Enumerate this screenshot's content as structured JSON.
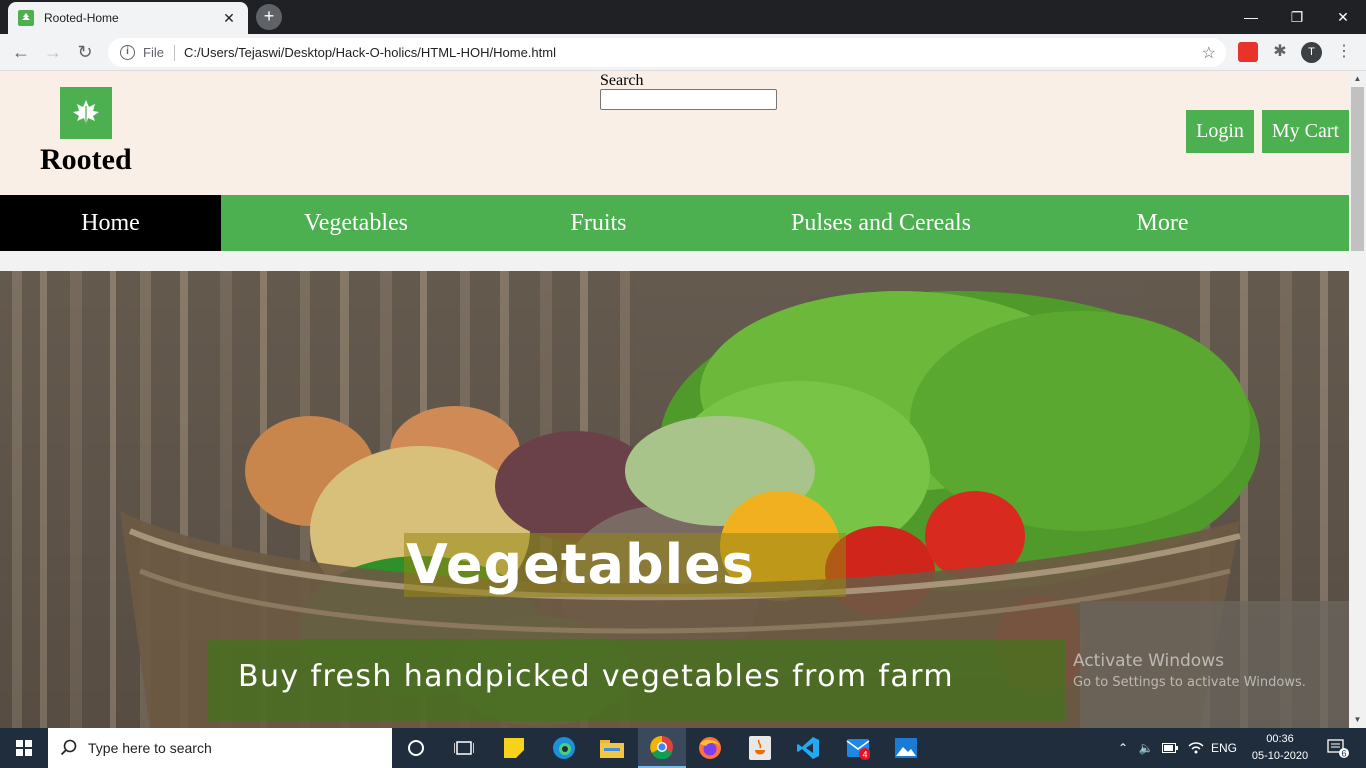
{
  "browser": {
    "tab_title": "Rooted-Home",
    "tab_close": "✕",
    "new_tab": "+",
    "url_scheme": "File",
    "url": "C:/Users/Tejaswi/Desktop/Hack-O-holics/HTML-HOH/Home.html",
    "profile_initial": "T",
    "window_controls": {
      "minimize": "—",
      "restore": "❐",
      "close": "✕"
    }
  },
  "site": {
    "brand": "Rooted",
    "search_label": "Search",
    "search_value": "",
    "login_label": "Login",
    "cart_label": "My Cart",
    "nav": [
      {
        "label": "Home",
        "active": true
      },
      {
        "label": "Vegetables",
        "active": false
      },
      {
        "label": "Fruits",
        "active": false
      },
      {
        "label": "Pulses and Cereals",
        "active": false
      },
      {
        "label": "More",
        "active": false
      }
    ],
    "hero": {
      "title": "Vegetables",
      "subtitle": "Buy fresh handpicked vegetables from farm"
    },
    "colors": {
      "accent": "#4caf50",
      "header_bg": "#f9efe6",
      "active_nav": "#000000"
    }
  },
  "os": {
    "activation_title": "Activate Windows",
    "activation_hint": "Go to Settings to activate Windows.",
    "taskbar_search_placeholder": "Type here to search",
    "language": "ENG",
    "time": "00:36",
    "date": "05-10-2020",
    "mail_badge": "4",
    "notification_count": "6"
  }
}
